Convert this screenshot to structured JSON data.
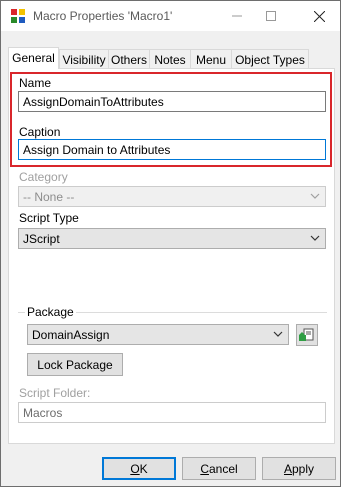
{
  "window": {
    "title": "Macro Properties 'Macro1'"
  },
  "tabs": [
    {
      "label": "General"
    },
    {
      "label": "Visibility"
    },
    {
      "label": "Others"
    },
    {
      "label": "Notes"
    },
    {
      "label": "Menu"
    },
    {
      "label": "Object Types"
    }
  ],
  "form": {
    "name_label": "Name",
    "name_value": "AssignDomainToAttributes",
    "caption_label": "Caption",
    "caption_value": "Assign Domain to Attributes",
    "category_label": "Category",
    "category_value": "-- None --",
    "script_type_label": "Script Type",
    "script_type_value": "JScript",
    "package_group_label": "Package",
    "package_value": "DomainAssign",
    "lock_package_label": "Lock Package",
    "script_folder_label": "Script Folder:",
    "script_folder_value": "Macros"
  },
  "footer": {
    "ok_accel": "O",
    "ok_rest": "K",
    "cancel_accel": "C",
    "cancel_rest": "ancel",
    "apply_accel": "A",
    "apply_rest": "pply"
  },
  "colors": {
    "highlight_border": "#d9262b",
    "focus_border": "#0078d7"
  },
  "icons": [
    "macro-app-icon",
    "minimize-icon",
    "maximize-icon",
    "close-icon",
    "chevron-down-icon",
    "package-browse-icon"
  ]
}
